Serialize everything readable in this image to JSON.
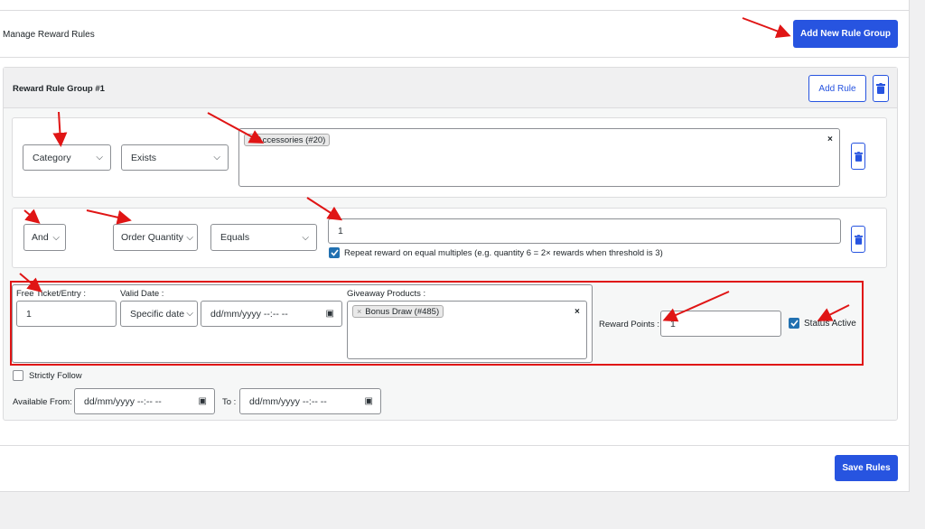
{
  "header": {
    "title": "Manage Reward Rules",
    "add_group_button": "Add New Rule Group"
  },
  "group": {
    "title": "Reward Rule Group #1",
    "add_rule_button": "Add Rule"
  },
  "rule1": {
    "field_select": "Category",
    "operator_select": "Exists",
    "tag": "Accessories (#20)",
    "clear": "×"
  },
  "rule2": {
    "logic_select": "And",
    "field_select": "Order Quantity",
    "operator_select": "Equals",
    "value": "1",
    "repeat_label": "Repeat reward on equal multiples (e.g. quantity 6 = 2× rewards when threshold is 3)",
    "repeat_checked": true
  },
  "reward": {
    "free_ticket_label": "Free Ticket/Entry :",
    "free_ticket_value": "1",
    "valid_date_label": "Valid Date :",
    "valid_date_select": "Specific date",
    "valid_date_placeholder": "dd/mm/yyyy --:-- --",
    "giveaway_label": "Giveaway Products :",
    "giveaway_tag": "Bonus Draw (#485)",
    "giveaway_clear": "×",
    "reward_points_label": "Reward Points :",
    "reward_points_value": "1",
    "status_label": "Status Active",
    "status_checked": true
  },
  "footer_options": {
    "strictly_follow_label": "Strictly Follow",
    "strictly_follow_checked": false,
    "available_from_label": "Available From:",
    "available_from_placeholder": "dd/mm/yyyy --:-- --",
    "to_label": "To :",
    "to_placeholder": "dd/mm/yyyy --:-- --"
  },
  "save_button": "Save Rules",
  "icons": {
    "chevron": "chevron-down-icon",
    "trash": "trash-icon",
    "calendar": "calendar-icon",
    "check": "checkmark-icon",
    "arrow": "red-arrow-annotation"
  },
  "colors": {
    "primary": "#2754e0",
    "annotation": "#e01515",
    "checkbox": "#2271b1"
  }
}
